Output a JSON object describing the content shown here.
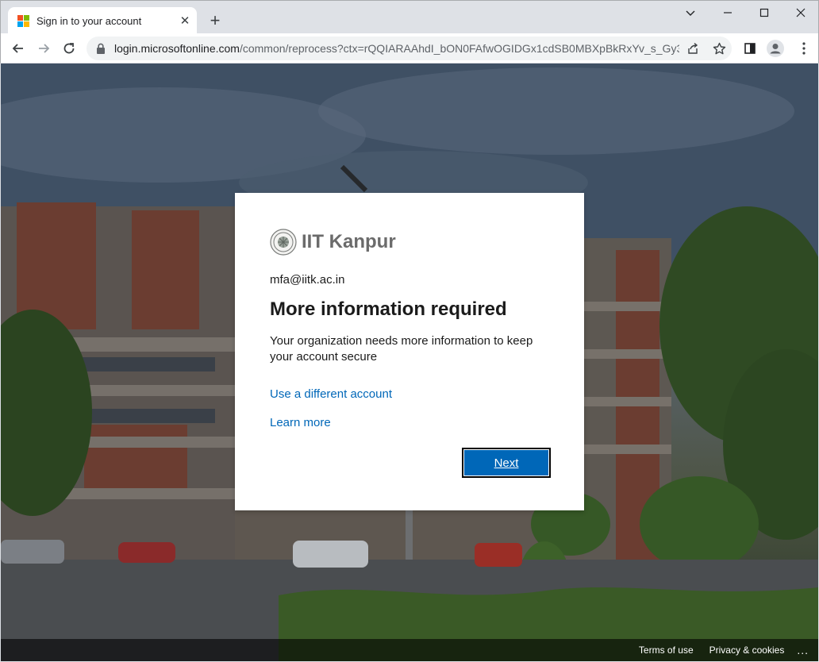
{
  "browser": {
    "tab": {
      "title": "Sign in to your account",
      "close_glyph": "✕"
    },
    "new_tab_glyph": "+",
    "address": {
      "host": "login.microsoftonline.com",
      "path": "/common/reprocess?ctx=rQQIARAAhdI_bON0FAfwOGIDGx1cdSB0MBXpBkRxYv_s_Gy3..."
    },
    "icons": {
      "back": "back-arrow-icon",
      "forward": "forward-arrow-icon",
      "reload": "reload-icon",
      "lock": "lock-icon",
      "share": "share-icon",
      "bookmark": "star-icon",
      "side_panel": "side-panel-icon",
      "profile": "profile-icon",
      "menu": "more-vertical-icon"
    }
  },
  "dialog": {
    "org_name": "IIT Kanpur",
    "identity": "mfa@iitk.ac.in",
    "heading": "More information required",
    "message": "Your organization needs more information to keep your account secure",
    "links": {
      "different_account": "Use a different account",
      "learn_more": "Learn more"
    },
    "next_label": "Next"
  },
  "footer": {
    "terms": "Terms of use",
    "privacy": "Privacy & cookies",
    "more": "..."
  },
  "colors": {
    "accent": "#0067b8",
    "link": "#0067b8",
    "ms_red": "#f25022",
    "ms_green": "#7fba00",
    "ms_blue": "#00a4ef",
    "ms_yellow": "#ffb900"
  }
}
